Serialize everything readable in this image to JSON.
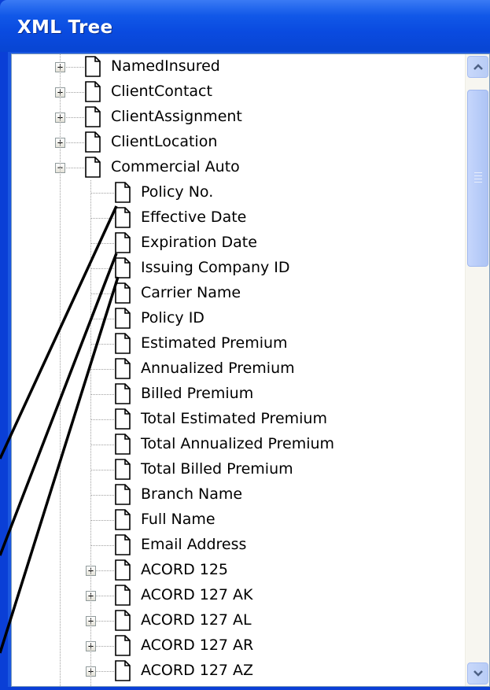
{
  "window": {
    "title": "XML Tree"
  },
  "tree": {
    "nodes": [
      {
        "label": "NamedInsured",
        "level": 0,
        "expander": "+"
      },
      {
        "label": "ClientContact",
        "level": 0,
        "expander": "+"
      },
      {
        "label": "ClientAssignment",
        "level": 0,
        "expander": "+"
      },
      {
        "label": "ClientLocation",
        "level": 0,
        "expander": "+"
      },
      {
        "label": "Commercial Auto",
        "level": 0,
        "expander": "−"
      },
      {
        "label": "Policy No.",
        "level": 1,
        "expander": ""
      },
      {
        "label": "Effective Date",
        "level": 1,
        "expander": ""
      },
      {
        "label": "Expiration Date",
        "level": 1,
        "expander": ""
      },
      {
        "label": "Issuing Company ID",
        "level": 1,
        "expander": ""
      },
      {
        "label": "Carrier Name",
        "level": 1,
        "expander": ""
      },
      {
        "label": "Policy ID",
        "level": 1,
        "expander": ""
      },
      {
        "label": "Estimated Premium",
        "level": 1,
        "expander": ""
      },
      {
        "label": "Annualized Premium",
        "level": 1,
        "expander": ""
      },
      {
        "label": "Billed Premium",
        "level": 1,
        "expander": ""
      },
      {
        "label": "Total Estimated Premium",
        "level": 1,
        "expander": ""
      },
      {
        "label": "Total Annualized Premium",
        "level": 1,
        "expander": ""
      },
      {
        "label": "Total Billed Premium",
        "level": 1,
        "expander": ""
      },
      {
        "label": "Branch Name",
        "level": 1,
        "expander": ""
      },
      {
        "label": "Full Name",
        "level": 1,
        "expander": ""
      },
      {
        "label": "Email Address",
        "level": 1,
        "expander": ""
      },
      {
        "label": "ACORD 125",
        "level": 1,
        "expander": "+"
      },
      {
        "label": "ACORD 127 AK",
        "level": 1,
        "expander": "+"
      },
      {
        "label": "ACORD 127 AL",
        "level": 1,
        "expander": "+"
      },
      {
        "label": "ACORD 127 AR",
        "level": 1,
        "expander": "+"
      },
      {
        "label": "ACORD 127 AZ",
        "level": 1,
        "expander": "+"
      }
    ]
  },
  "icons": {
    "node": "document-icon",
    "scroll_up": "arrow-up-icon",
    "scroll_down": "arrow-down-icon"
  },
  "colors": {
    "titlebar": "#0a4be0",
    "frame": "#1b57e0",
    "scrollbar_thumb": "#b6cbf8"
  }
}
